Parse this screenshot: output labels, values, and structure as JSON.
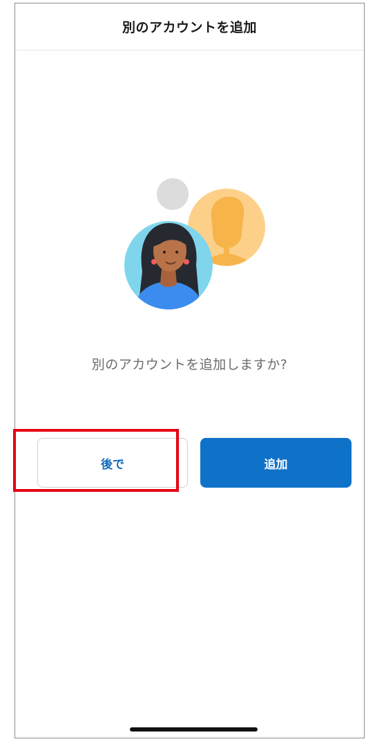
{
  "header": {
    "title": "別のアカウントを追加"
  },
  "main": {
    "illustration": "add-account-people-illustration",
    "prompt": "別のアカウントを追加しますか?",
    "buttons": {
      "later_label": "後で",
      "add_label": "追加"
    }
  },
  "annotation": {
    "highlight_color": "#e60012"
  },
  "colors": {
    "accent": "#0f72c9",
    "link": "#0f6cbd"
  }
}
